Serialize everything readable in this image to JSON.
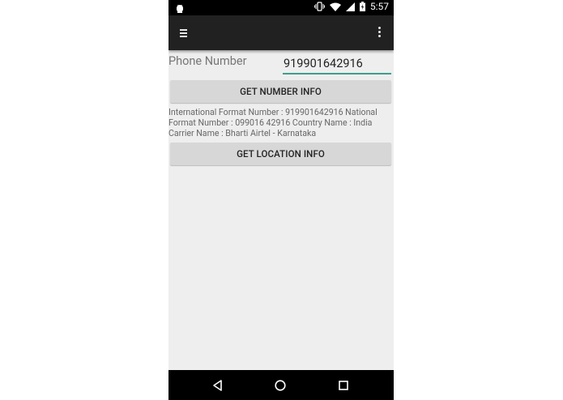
{
  "status_bar": {
    "time": "5:57",
    "icons": [
      "android-icon",
      "vibrate-icon",
      "wifi-icon",
      "signal-icon",
      "battery-charging-icon"
    ]
  },
  "app_bar": {
    "icons": [
      "menu-icon",
      "overflow-menu-icon"
    ]
  },
  "form": {
    "phone_label": "Phone Number",
    "phone_value": "919901642916",
    "get_number_info_label": "GET NUMBER INFO",
    "number_info_text": "International Format Number : 919901642916 National Format Number : 099016 42916 Country Name : India Carrier Name : Bharti Airtel - Karnataka",
    "get_location_info_label": "GET LOCATION INFO"
  },
  "nav_bar": {
    "icons": [
      "back-icon",
      "home-icon",
      "recent-apps-icon"
    ]
  },
  "colors": {
    "status_bar": "#000000",
    "app_bar": "#212121",
    "background": "#eeeeee",
    "accent": "#3f9e90",
    "button": "#d7d7d7"
  }
}
